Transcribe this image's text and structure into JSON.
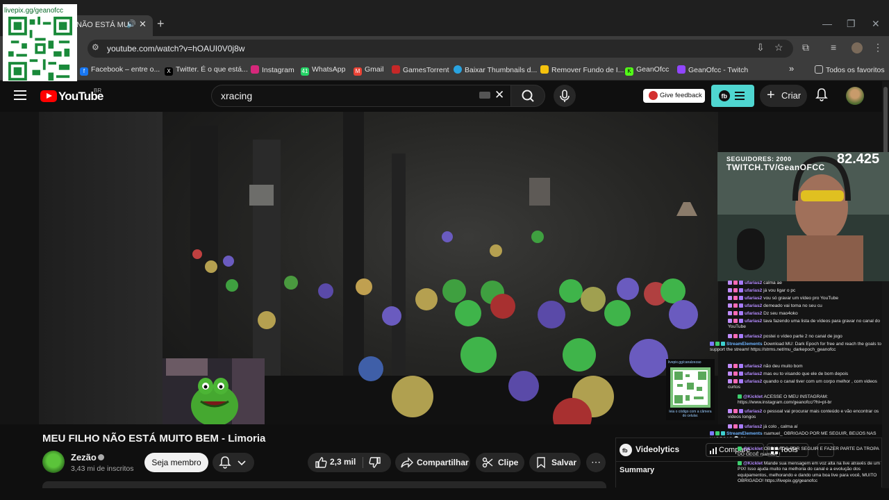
{
  "browser": {
    "tab_title": "NÃO ESTÁ MUI",
    "url": "youtube.com/watch?v=hOAUI0V0j8w",
    "bookmarks": [
      {
        "label": "Facebook – entre o...",
        "icon": "facebook-icon",
        "color": "#1877f2"
      },
      {
        "label": "Twitter. É o que está...",
        "icon": "x-icon",
        "color": "#000000"
      },
      {
        "label": "Instagram",
        "icon": "instagram-icon",
        "color": "#d6287b"
      },
      {
        "label": "WhatsApp",
        "icon": "whatsapp-icon",
        "color": "#25d366",
        "badge": "41"
      },
      {
        "label": "Gmail",
        "icon": "gmail-icon",
        "color": "#ea4335"
      },
      {
        "label": "GamesTorrent",
        "icon": "gamestorrent-icon",
        "color": "#c62828"
      },
      {
        "label": "Baixar Thumbnails d...",
        "icon": "thumbnails-icon",
        "color": "#29a3e0"
      },
      {
        "label": "Remover Fundo de I...",
        "icon": "remove-bg-icon",
        "color": "#f4c20d"
      },
      {
        "label": "GeanOfcc",
        "icon": "kick-icon",
        "color": "#53fc18"
      },
      {
        "label": "GeanOfcc - Twitch",
        "icon": "twitch-icon",
        "color": "#9146ff"
      }
    ],
    "all_bookmarks": "Todos os favoritos"
  },
  "overlay_qr": {
    "text": "livepix.gg/geanofcc"
  },
  "youtube": {
    "logo_text": "YouTube",
    "country": "BR",
    "search_value": "xracing",
    "feedback": "Give feedback",
    "create": "Criar"
  },
  "stream_overlay": {
    "followers": "SEGUIDORES: 2000",
    "twitch": "TWITCH.TV/GeanOFCC",
    "count": "82.425",
    "qr_top": "livepix.gg/canalzezao",
    "qr_bottom": "leia o código com a câmera do celular."
  },
  "chat": [
    {
      "user": "ufarias2",
      "text": "calma ae"
    },
    {
      "user": "ufarias2",
      "text": "já vou ligar o pc"
    },
    {
      "user": "ufarias2",
      "text": "vou só gravar um vídeo pro YouTube"
    },
    {
      "user": "ufarias2",
      "text": "demeado vai toma no seu cu"
    },
    {
      "user": "ufarias2",
      "text": "Dz seu mao4oko"
    },
    {
      "user": "ufarias2",
      "text": "tava fazendo uma lista de vídeos para gravar no canal do YouTube"
    },
    {
      "user": "ufarias2",
      "text": "postei o vídeo parte 2 no canal de jogo"
    },
    {
      "user": "StreamElements",
      "text": "Download MU: Dark Epoch for free and reach the goals to support the stream! https://strms.net/mu_darkepoch_geanofcc"
    },
    {
      "user": "ufarias2",
      "text": "não deu muito bom"
    },
    {
      "user": "ufarias2",
      "text": "mas eu to visando que ele de bom depois"
    },
    {
      "user": "ufarias2",
      "text": "quando o canal tiver com um corpo melhor , com videos curtos"
    },
    {
      "user": "@Kicklet",
      "text": "ACESSE O MEU INSTAGRAM: https://www.instagram.com/geanofcc/?hl=pt-br"
    },
    {
      "user": "ufarias2",
      "text": "o pessoal vai procurar mais conteúdo e vão encontrar os videos longos"
    },
    {
      "user": "ufarias2",
      "text": "já colo , calma aí"
    },
    {
      "user": "StreamElements",
      "text": "rsamuel_ OBRIGADO POR ME SEGUIR, BEIJOS NAS NADEGAS 💀 S2"
    },
    {
      "user": "@Kicklet",
      "text": "OBRIGADO POR SEGUIR E FAZER PARTE DA TROPA DO GEGÊ rsamuel_!"
    },
    {
      "user": "@Kicklet",
      "text": "Mande sua mensagem em voz alta na live através de um PIX! Isso ajuda muito na melhoria do canal e a evolução dos equipamentos, melhorando e dando uma boa live para você, MUITO OBRIGADO! https://livepix.gg/geanofcc"
    }
  ],
  "video": {
    "title": "MEU FILHO NÃO ESTÁ MUITO BEM - Limoria",
    "channel": "Zezão",
    "subscribers": "3,43 mi de inscritos",
    "join": "Seja membro",
    "likes": "2,3 mil",
    "share": "Compartilhar",
    "clip": "Clipe",
    "save": "Salvar"
  },
  "videolytics": {
    "title": "Videolytics",
    "compare": "Compare",
    "tools": "Tools",
    "summary": "Summary"
  }
}
